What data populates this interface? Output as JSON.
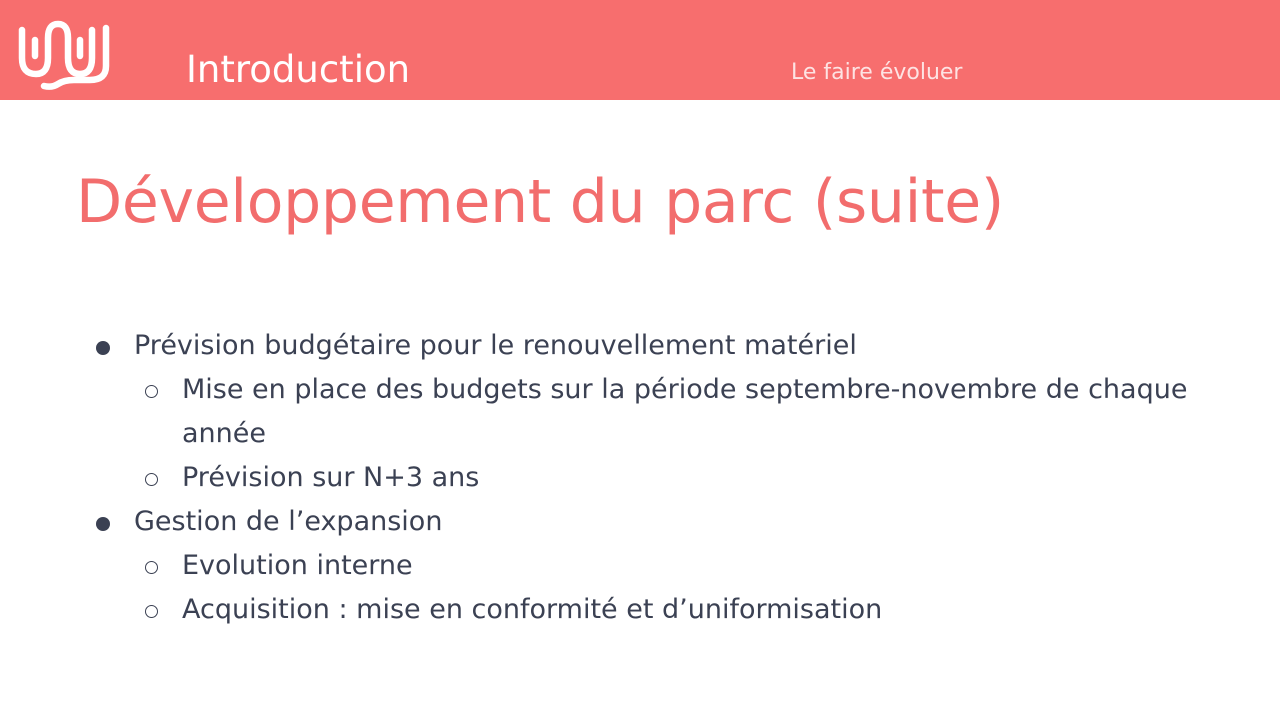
{
  "header": {
    "logo_icon": "wave-logo-icon",
    "section_title": "Introduction",
    "section_subtitle": "Le faire évoluer",
    "background_color": "#f76e6e"
  },
  "slide": {
    "title": "Développement du parc (suite)",
    "title_color": "#f26d6d",
    "bullets": [
      {
        "text": "Prévision budgétaire pour le renouvellement matériel",
        "children": [
          "Mise en place des budgets sur la période septembre-novembre de chaque année",
          "Prévision sur N+3 ans"
        ]
      },
      {
        "text": "Gestion de l’expansion",
        "children": [
          "Evolution interne",
          "Acquisition : mise en conformité et d’uniformisation"
        ]
      }
    ]
  }
}
